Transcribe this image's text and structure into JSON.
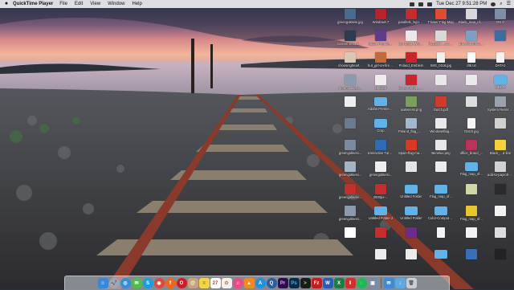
{
  "menubar": {
    "app_name": "QuickTime Player",
    "menus": [
      "File",
      "Edit",
      "View",
      "Window",
      "Help"
    ],
    "clock": "Tue Dec 27  9:51:28 PM",
    "status_icons": [
      "wifi-icon",
      "volume-icon",
      "battery-icon",
      "user-icon",
      "search-icon",
      "list-icon"
    ]
  },
  "desktop": {
    "columns_x": [
      436,
      474,
      512,
      549,
      587,
      623
    ],
    "icons": [
      {
        "label": "greengokkesi.jpg",
        "type": "image",
        "color": "#4a6b8c",
        "col": 0,
        "row": 0
      },
      {
        "label": "Windows 7",
        "type": "image",
        "color": "#b8232a",
        "col": 1,
        "row": 0
      },
      {
        "label": "parallels_logo1.jpg",
        "type": "image",
        "color": "#c82b2b",
        "col": 2,
        "row": 0
      },
      {
        "label": "Flower-Flag-Map",
        "type": "image",
        "color": "#e24b2f",
        "col": 3,
        "row": 0
      },
      {
        "label": "Blank_map_of_Belgium",
        "type": "image",
        "color": "#d8d8d8",
        "col": 4,
        "row": 0
      },
      {
        "label": "OS X",
        "type": "image",
        "color": "#7d8fa8",
        "col": 5,
        "row": 0
      },
      {
        "label": "Screen Shot 2016-1...8.31 PM",
        "type": "image",
        "color": "#2f3c4f",
        "col": 0,
        "row": 1
      },
      {
        "label": "Adobe Premiere Pro...",
        "type": "image",
        "color": "#5c3d8a",
        "col": 1,
        "row": 1
      },
      {
        "label": "Go_hana_Windows_to_Mac_...",
        "type": "image",
        "color": "#e9e9e9",
        "col": 2,
        "row": 1
      },
      {
        "label": "Rozajski_...ovpolana",
        "type": "image",
        "color": "#d9d9d9",
        "col": 3,
        "row": 1
      },
      {
        "label": "drawMacroIcon 110x110.png",
        "type": "image",
        "color": "#7e9fc2",
        "col": 4,
        "row": 1
      },
      {
        "label": "",
        "type": "image",
        "color": "#3f6b9e",
        "col": 5,
        "row": 1
      },
      {
        "label": "choosingheart...",
        "type": "image",
        "color": "#d8c8b8",
        "col": 0,
        "row": 2
      },
      {
        "label": "hut_girl-on-fire-wallp...",
        "type": "image",
        "color": "#c26a3b",
        "col": 1,
        "row": 2
      },
      {
        "label": "Poland_Emblem",
        "type": "image",
        "color": "#c9252a",
        "col": 2,
        "row": 2
      },
      {
        "label": "IMG_0118.jpg",
        "type": "doc",
        "color": "#f0f0f0",
        "col": 3,
        "row": 2
      },
      {
        "label": "dtb.txt",
        "type": "doc",
        "color": "#fafafa",
        "col": 4,
        "row": 2
      },
      {
        "label": "DATA1",
        "type": "doc",
        "color": "#f4f4f4",
        "col": 5,
        "row": 2
      },
      {
        "label": "greengokkesi...",
        "type": "image",
        "color": "#8a9bb0",
        "col": 0,
        "row": 3
      },
      {
        "label": "Untitled",
        "type": "image",
        "color": "#ededed",
        "col": 1,
        "row": 3
      },
      {
        "label": "Screen Shot...png",
        "type": "image",
        "color": "#c9252a",
        "col": 2,
        "row": 3
      },
      {
        "label": "",
        "type": "image",
        "color": "#e8e8e8",
        "col": 3,
        "row": 3
      },
      {
        "label": "",
        "type": "image",
        "color": "#eaeaea",
        "col": 4,
        "row": 3
      },
      {
        "label": "MEDIA",
        "type": "folder",
        "color": "#5fb3e8",
        "col": 5,
        "row": 3
      },
      {
        "label": "",
        "type": "image",
        "color": "#eeeeee",
        "col": 0,
        "row": 4
      },
      {
        "label": "Adobe Premiere Pro Auto-Save",
        "type": "folder",
        "color": "#5fb3e8",
        "col": 1,
        "row": 4
      },
      {
        "label": "aakeness.png",
        "type": "image",
        "color": "#7aa05e",
        "col": 2,
        "row": 4
      },
      {
        "label": "Dutch.pdf",
        "type": "image",
        "color": "#cf3b2b",
        "col": 3,
        "row": 4
      },
      {
        "label": "",
        "type": "image",
        "color": "#dddddd",
        "col": 4,
        "row": 4
      },
      {
        "label": "System Reserved",
        "type": "image",
        "color": "#9aa3ad",
        "col": 5,
        "row": 4
      },
      {
        "label": "",
        "type": "image",
        "color": "#6a7b8d",
        "col": 0,
        "row": 5
      },
      {
        "label": "Crop",
        "type": "folder",
        "color": "#5fb3e8",
        "col": 1,
        "row": 5
      },
      {
        "label": "Poland_flag_map.png",
        "type": "image",
        "color": "#a3b7cc",
        "col": 2,
        "row": 5
      },
      {
        "label": "Windowsflag...",
        "type": "image",
        "color": "#eaeaea",
        "col": 3,
        "row": 5
      },
      {
        "label": "Dutch.jpg",
        "type": "doc",
        "color": "#f5f5f5",
        "col": 4,
        "row": 5
      },
      {
        "label": "",
        "type": "image",
        "color": "#d0d0d0",
        "col": 5,
        "row": 5
      },
      {
        "label": "greengokkesi...",
        "type": "image",
        "color": "#7c8aa0",
        "col": 0,
        "row": 6
      },
      {
        "label": "Interactive Tutorials",
        "type": "image",
        "color": "#2d6db5",
        "col": 1,
        "row": 6
      },
      {
        "label": "Spain-flag-map-pub.png",
        "type": "image",
        "color": "#d93a25",
        "col": 2,
        "row": 6
      },
      {
        "label": "Benelux.png",
        "type": "image",
        "color": "#e7e7e7",
        "col": 3,
        "row": 6
      },
      {
        "label": "office_brand_...",
        "type": "image",
        "color": "#b8325a",
        "col": 4,
        "row": 6
      },
      {
        "label": "Black_...d-line",
        "type": "image",
        "color": "#f6d23c",
        "col": 5,
        "row": 6
      },
      {
        "label": "greengokkesi...",
        "type": "image",
        "color": "#a4b4c4",
        "col": 0,
        "row": 7
      },
      {
        "label": "greengokkesi...",
        "type": "image",
        "color": "#eeeeee",
        "col": 1,
        "row": 7
      },
      {
        "label": "",
        "type": "image",
        "color": "#e5e5e5",
        "col": 2,
        "row": 7
      },
      {
        "label": "",
        "type": "image",
        "color": "#ececec",
        "col": 3,
        "row": 7
      },
      {
        "label": "Flag_map_of...",
        "type": "folder",
        "color": "#5fb3e8",
        "col": 4,
        "row": 7
      },
      {
        "label": "add-to-payroll-ss...",
        "type": "image",
        "color": "#d1d1d1",
        "col": 5,
        "row": 7
      },
      {
        "label": "greengokkesi...",
        "type": "image",
        "color": "#c62d2d",
        "col": 0,
        "row": 8
      },
      {
        "label": "2000px-...",
        "type": "image",
        "color": "#c62d2d",
        "col": 1,
        "row": 8
      },
      {
        "label": "Untitled Folder",
        "type": "folder",
        "color": "#5fb3e8",
        "col": 2,
        "row": 8
      },
      {
        "label": "Flag_map_of...",
        "type": "folder",
        "color": "#5fb3e8",
        "col": 3,
        "row": 8
      },
      {
        "label": "",
        "type": "image",
        "color": "#cfd8a0",
        "col": 4,
        "row": 8
      },
      {
        "label": "",
        "type": "image",
        "color": "#2a2a2a",
        "col": 5,
        "row": 8
      },
      {
        "label": "greengokkesi...",
        "type": "image",
        "color": "#8c9aac",
        "col": 0,
        "row": 9
      },
      {
        "label": "Untitled Folder 2",
        "type": "folder",
        "color": "#5fb3e8",
        "col": 1,
        "row": 9
      },
      {
        "label": "Untitled Folder",
        "type": "folder",
        "color": "#5fb3e8",
        "col": 2,
        "row": 9
      },
      {
        "label": "Color-Computer-...",
        "type": "folder",
        "color": "#5fb3e8",
        "col": 3,
        "row": 9
      },
      {
        "label": "Flag_map_of...",
        "type": "image",
        "color": "#e8c52f",
        "col": 4,
        "row": 9
      },
      {
        "label": "",
        "type": "image",
        "color": "#f2f2f2",
        "col": 5,
        "row": 9
      },
      {
        "label": "",
        "type": "image",
        "color": "#ffffff",
        "col": 0,
        "row": 10
      },
      {
        "label": "",
        "type": "image",
        "color": "#c62d2d",
        "col": 1,
        "row": 10
      },
      {
        "label": "",
        "type": "image",
        "color": "#6b2c8c",
        "col": 2,
        "row": 10
      },
      {
        "label": "",
        "type": "doc",
        "color": "#f4f4f4",
        "col": 3,
        "row": 10
      },
      {
        "label": "",
        "type": "image",
        "color": "#f2f2f2",
        "col": 4,
        "row": 10
      },
      {
        "label": "",
        "type": "image",
        "color": "#dddddd",
        "col": 5,
        "row": 10
      },
      {
        "label": "",
        "type": "image",
        "color": "#ececec",
        "col": 1,
        "row": 11
      },
      {
        "label": "",
        "type": "image",
        "color": "#ececec",
        "col": 2,
        "row": 11
      },
      {
        "label": "",
        "type": "folder",
        "color": "#5fb3e8",
        "col": 3,
        "row": 11
      },
      {
        "label": "",
        "type": "image",
        "color": "#3b6fb5",
        "col": 4,
        "row": 11
      },
      {
        "label": "",
        "type": "image",
        "color": "#222222",
        "col": 5,
        "row": 11
      }
    ]
  },
  "dock": {
    "apps": [
      {
        "name": "Finder",
        "icon": "finder-icon",
        "bg": "#3a86d8",
        "fg": "#ffffff",
        "glyph": "☺",
        "round": false
      },
      {
        "name": "Launchpad",
        "icon": "launchpad-icon",
        "bg": "#9aa7b8",
        "fg": "#ffffff",
        "glyph": "🚀",
        "round": true
      },
      {
        "name": "Safari",
        "icon": "safari-icon",
        "bg": "#2f8fd8",
        "fg": "#ffffff",
        "glyph": "◎",
        "round": true
      },
      {
        "name": "Messages",
        "icon": "messages-icon",
        "bg": "#4cc04a",
        "fg": "#ffffff",
        "glyph": "✉",
        "round": true
      },
      {
        "name": "Skype",
        "icon": "skype-icon",
        "bg": "#16a0e2",
        "fg": "#ffffff",
        "glyph": "S",
        "round": true
      },
      {
        "name": "Chrome",
        "icon": "chrome-icon",
        "bg": "#e0463a",
        "fg": "#ffffff",
        "glyph": "◉",
        "round": true
      },
      {
        "name": "Firefox",
        "icon": "firefox-icon",
        "bg": "#e66a1f",
        "fg": "#ffffff",
        "glyph": "f",
        "round": true
      },
      {
        "name": "Opera",
        "icon": "opera-icon",
        "bg": "#cc1b2b",
        "fg": "#ffffff",
        "glyph": "O",
        "round": true
      },
      {
        "name": "Contacts",
        "icon": "contacts-icon",
        "bg": "#c7a27a",
        "fg": "#ffffff",
        "glyph": "@",
        "round": false
      },
      {
        "name": "Notes",
        "icon": "notes-icon",
        "bg": "#f2d34a",
        "fg": "#6a5a20",
        "glyph": "≡",
        "round": false
      },
      {
        "name": "Calendar",
        "icon": "calendar-icon",
        "bg": "#ffffff",
        "fg": "#d23a2a",
        "glyph": "27",
        "round": false
      },
      {
        "name": "Photos",
        "icon": "photos-icon",
        "bg": "#f2f2f2",
        "fg": "#e47b2b",
        "glyph": "✿",
        "round": false
      },
      {
        "name": "iTunes",
        "icon": "itunes-icon",
        "bg": "#e94b8a",
        "fg": "#ffffff",
        "glyph": "♫",
        "round": true
      },
      {
        "name": "VLC",
        "icon": "vlc-icon",
        "bg": "#f08a24",
        "fg": "#ffffff",
        "glyph": "▲",
        "round": false
      },
      {
        "name": "App Store",
        "icon": "app-store-icon",
        "bg": "#1f8fe0",
        "fg": "#ffffff",
        "glyph": "A",
        "round": true
      },
      {
        "name": "QuickTime",
        "icon": "quicktime-icon",
        "bg": "#2d5c9a",
        "fg": "#ffffff",
        "glyph": "Q",
        "round": true
      },
      {
        "name": "Premiere Pro",
        "icon": "premiere-icon",
        "bg": "#2a0f4a",
        "fg": "#d9a6ff",
        "glyph": "Pr",
        "round": false
      },
      {
        "name": "Photoshop",
        "icon": "photoshop-icon",
        "bg": "#0c2a45",
        "fg": "#3fb0f0",
        "glyph": "Ps",
        "round": false
      },
      {
        "name": "Terminal",
        "icon": "terminal-icon",
        "bg": "#1b1b1b",
        "fg": "#7cff7c",
        "glyph": ">",
        "round": false
      },
      {
        "name": "FileZilla",
        "icon": "filezilla-icon",
        "bg": "#bf1f1f",
        "fg": "#ffffff",
        "glyph": "Fz",
        "round": false
      },
      {
        "name": "Word",
        "icon": "word-icon",
        "bg": "#2b5eb0",
        "fg": "#ffffff",
        "glyph": "W",
        "round": false
      },
      {
        "name": "Excel",
        "icon": "excel-icon",
        "bg": "#1e7d44",
        "fg": "#ffffff",
        "glyph": "X",
        "round": false
      },
      {
        "name": "Parallels",
        "icon": "parallels-icon",
        "bg": "#d32f2f",
        "fg": "#ffffff",
        "glyph": "‖",
        "round": false
      },
      {
        "name": "Spotify",
        "icon": "spotify-icon",
        "bg": "#1db954",
        "fg": "#ffffff",
        "glyph": "◌",
        "round": true
      },
      {
        "name": "Preview",
        "icon": "preview-icon",
        "bg": "#7b8ba0",
        "fg": "#ffffff",
        "glyph": "▣",
        "round": false
      }
    ],
    "stacks": [
      {
        "name": "Mail",
        "icon": "mail-icon",
        "bg": "#3d8ad6",
        "fg": "#ffffff",
        "glyph": "✉",
        "round": false
      },
      {
        "name": "Downloads",
        "icon": "downloads-icon",
        "bg": "#5fa9df",
        "fg": "#ffffff",
        "glyph": "↓",
        "round": false
      },
      {
        "name": "Trash",
        "icon": "trash-icon",
        "bg": "#c9ced6",
        "fg": "#5a5f66",
        "glyph": "🗑",
        "round": false
      }
    ]
  }
}
